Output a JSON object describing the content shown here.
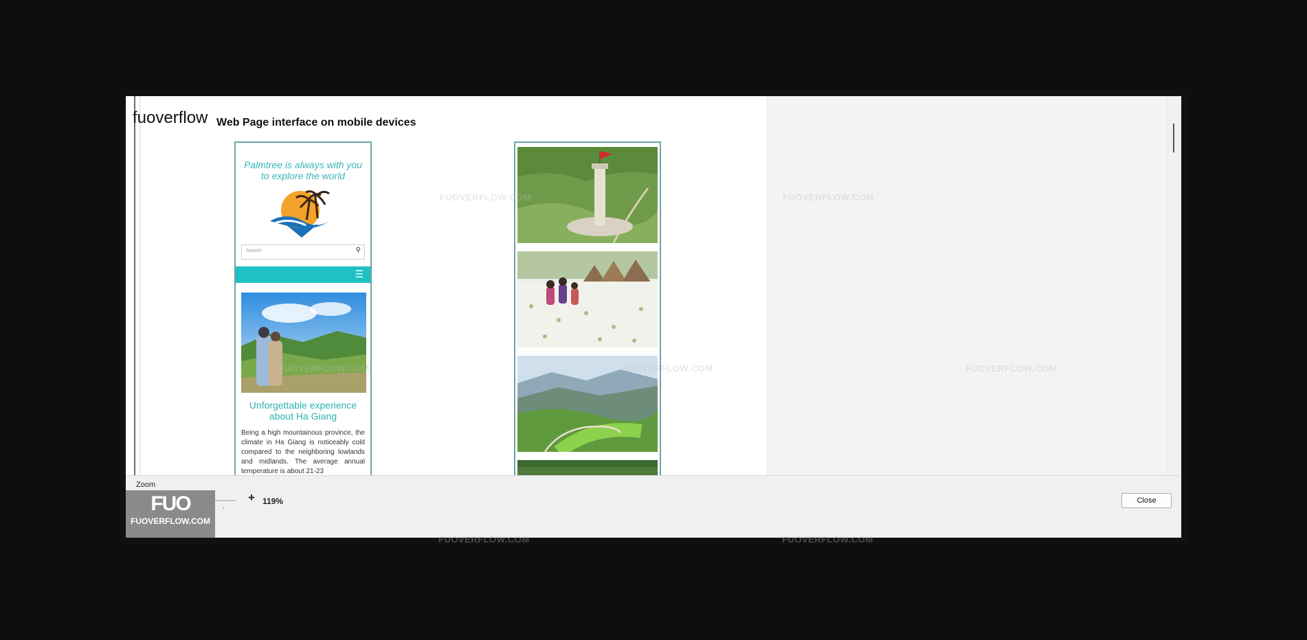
{
  "document": {
    "brand": "fuoverflow",
    "heading": "Web Page interface on mobile devices"
  },
  "mobile_page": {
    "tagline": "Palmtree is always with you to explore the world",
    "search_placeholder": "Search",
    "article_title": "Unforgettable experience about Ha Giang",
    "article_body": "Being a high mountainous province, the climate in Ha Giang is noticeably cold compared to the neighboring lowlands and midlands. The average annual temperature is about 21-23"
  },
  "watermark": {
    "text": "FUOVERFLOW.COM"
  },
  "zoom_panel": {
    "label": "Zoom",
    "minus": "-",
    "plus": "+",
    "percent": "119%",
    "level_fraction": 0.72,
    "close_label": "Close"
  },
  "badge": {
    "logo_text": "FUO",
    "site_text": "FUOVERFLOW.COM"
  },
  "colors": {
    "accent_teal": "#1fc1c3",
    "slider_thumb": "#1a6fc2"
  }
}
